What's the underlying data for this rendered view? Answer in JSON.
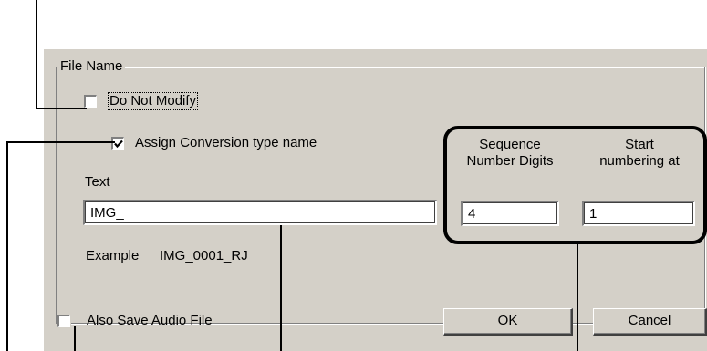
{
  "file_name_group": {
    "legend": "File Name",
    "do_not_modify": {
      "label": "Do Not Modify",
      "checked": false
    },
    "assign_conversion": {
      "label": "Assign Conversion type name",
      "checked": true
    },
    "text_label": "Text",
    "text_value": "IMG_",
    "example_label": "Example",
    "example_value": "IMG_0001_RJ",
    "sequence_digits": {
      "label_line1": "Sequence",
      "label_line2": "Number Digits",
      "value": "4"
    },
    "start_numbering": {
      "label_line1": "Start",
      "label_line2": "numbering at",
      "value": "1"
    }
  },
  "also_save_audio": {
    "label": "Also Save Audio File",
    "checked": false
  },
  "buttons": {
    "ok": "OK",
    "cancel": "Cancel"
  }
}
